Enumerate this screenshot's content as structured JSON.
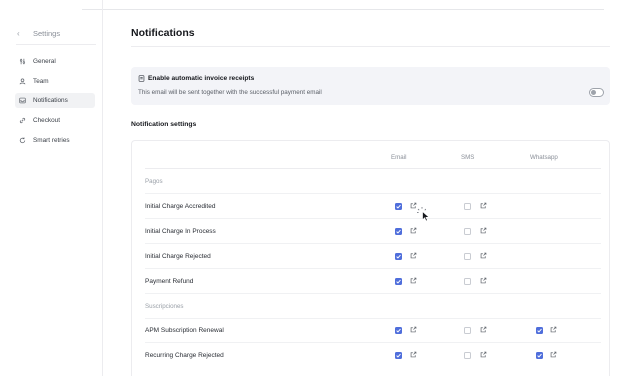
{
  "sidebar": {
    "back_label": "Settings",
    "items": [
      {
        "label": "General",
        "icon": "sliders-icon",
        "active": false
      },
      {
        "label": "Team",
        "icon": "user-icon",
        "active": false
      },
      {
        "label": "Notifications",
        "icon": "inbox-icon",
        "active": true
      },
      {
        "label": "Checkout",
        "icon": "link-icon",
        "active": false
      },
      {
        "label": "Smart retries",
        "icon": "refresh-icon",
        "active": false
      }
    ]
  },
  "page": {
    "title": "Notifications"
  },
  "banner": {
    "icon": "receipt-icon",
    "title": "Enable automatic invoice receipts",
    "subtitle": "This email will be sent together with the successful payment email",
    "toggle_on": false
  },
  "settings": {
    "title": "Notification settings",
    "columns": [
      "Email",
      "SMS",
      "Whatsapp"
    ],
    "groups": [
      {
        "label": "Pagos",
        "rows": [
          {
            "label": "Initial Charge Accredited",
            "email": true,
            "sms": false,
            "whatsapp": null
          },
          {
            "label": "Initial Charge In Process",
            "email": true,
            "sms": false,
            "whatsapp": null
          },
          {
            "label": "Initial Charge Rejected",
            "email": true,
            "sms": false,
            "whatsapp": null
          },
          {
            "label": "Payment Refund",
            "email": true,
            "sms": false,
            "whatsapp": null
          }
        ]
      },
      {
        "label": "Suscripciones",
        "rows": [
          {
            "label": "APM Subscription Renewal",
            "email": true,
            "sms": false,
            "whatsapp": true
          },
          {
            "label": "Recurring Charge Rejected",
            "email": true,
            "sms": false,
            "whatsapp": true
          }
        ]
      }
    ]
  },
  "colors": {
    "accent": "#4f6edb",
    "banner_bg": "#f3f4f8",
    "active_item_bg": "#f1f2f4"
  }
}
